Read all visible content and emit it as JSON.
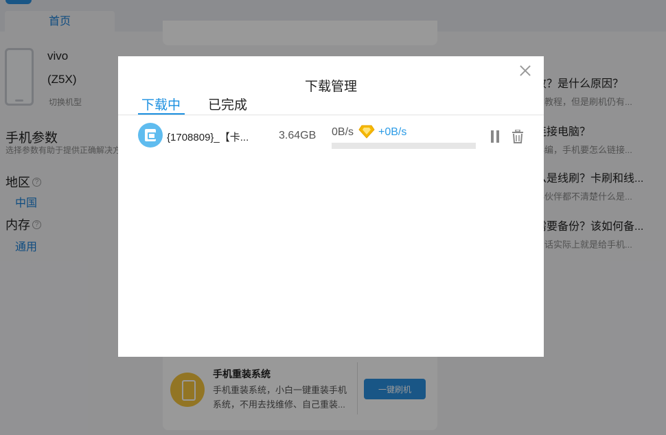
{
  "app": {
    "nav": {
      "home_tab": "首页"
    },
    "device": {
      "brand": "vivo",
      "model": "(Z5X)",
      "switch_label": "切换机型"
    },
    "params": {
      "title": "手机参数",
      "subtitle": "选择参数有助于提供正确解决方",
      "region_label": "地区",
      "region_value": "中国",
      "memory_label": "内存",
      "memory_value": "通用"
    },
    "faq": [
      {
        "title": "败？是什么原因？",
        "desc": "的教程，但是刷机仍有..."
      },
      {
        "title": "连接电脑？",
        "desc": "小编，手机要怎么链接..."
      },
      {
        "title": "么是线刷？卡刷和线...",
        "desc": "小伙伴都不清楚什么是..."
      },
      {
        "title": "需要备份？该如何备...",
        "desc": "的话实际上就是给手机..."
      }
    ],
    "reinstall": {
      "title": "手机重装系统",
      "desc": "手机重装系统，小白一键重装手机系统，不用去找维修、自己重装...",
      "button": "一键刷机"
    }
  },
  "dialog": {
    "title": "下载管理",
    "tabs": {
      "downloading": "下载中",
      "completed": "已完成"
    },
    "downloads": [
      {
        "name": "{1708809}_【卡...",
        "size": "3.64GB",
        "speed": "0B/s",
        "vip_speed": "+0B/s",
        "progress": 0
      }
    ]
  },
  "colors": {
    "accent": "#1a8fe0",
    "vip_speed": "#2b9be6",
    "overlay": "rgba(0,0,0,0.40)",
    "vip_gem": "#f5b800"
  },
  "icons": {
    "close": "close-icon",
    "file": "lock-phone-icon",
    "vip": "diamond-icon",
    "pause": "pause-icon",
    "delete": "trash-icon"
  }
}
